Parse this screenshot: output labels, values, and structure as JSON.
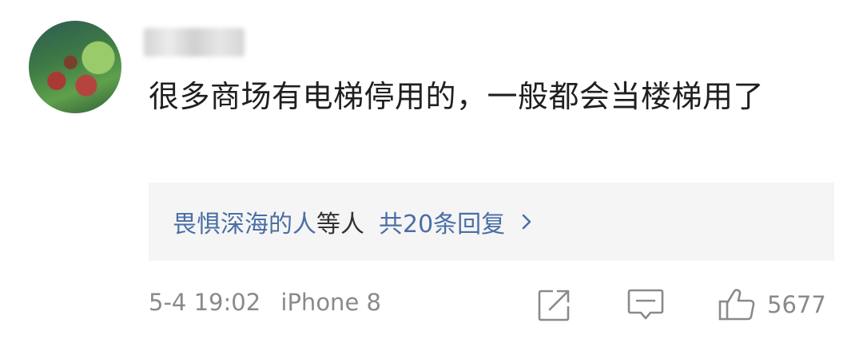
{
  "post": {
    "comment_text": "很多商场有电梯停用的，一般都会当楼梯用了",
    "replies": {
      "names": "畏惧深海的人",
      "suffix": "等人",
      "count_label": "共20条回复"
    },
    "meta": {
      "timestamp": "5-4 19:02",
      "device": "iPhone 8"
    },
    "likes": "5677"
  },
  "colors": {
    "link": "#4a6fa5",
    "meta": "#8a8a8a",
    "reply_bg": "#f5f5f5"
  },
  "icons": [
    "share-icon",
    "comment-icon",
    "like-icon",
    "chevron-right-icon"
  ]
}
